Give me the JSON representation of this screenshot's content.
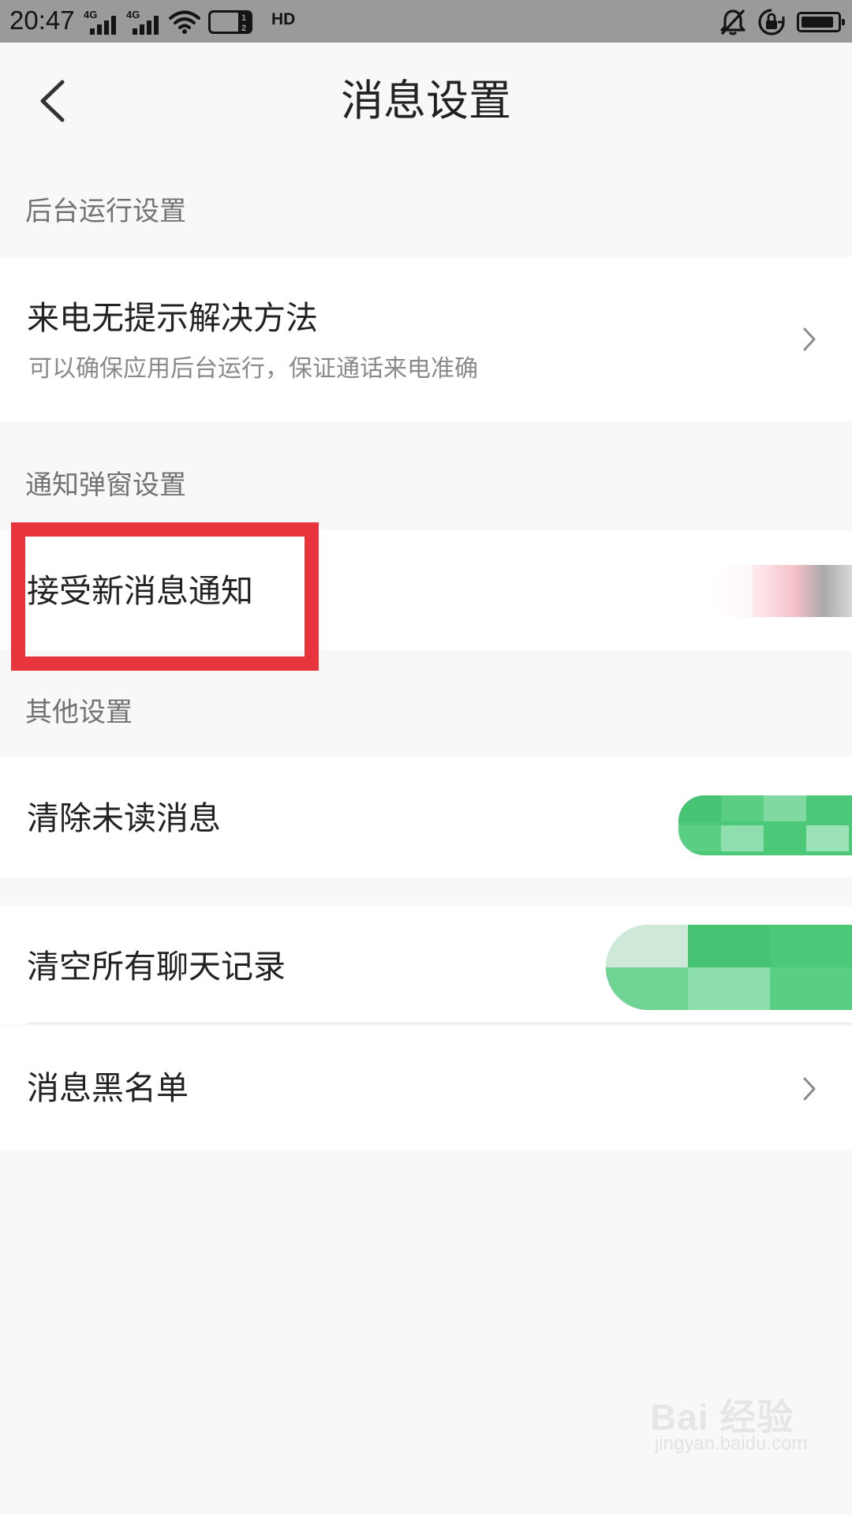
{
  "status_bar": {
    "time": "20:47",
    "network_1": "4G",
    "network_2": "4G",
    "hd_label": "HD",
    "icons": [
      "signal-4g-icon",
      "signal-4g-icon",
      "wifi-icon",
      "hd-voice-icon",
      "bell-muted-icon",
      "rotation-lock-icon",
      "battery-icon"
    ],
    "battery_level": 0.9
  },
  "header": {
    "back_icon": "chevron-left-icon",
    "title": "消息设置"
  },
  "sections": {
    "background": {
      "header": "后台运行设置",
      "items": [
        {
          "title": "来电无提示解决方法",
          "subtitle": "可以确保应用后台运行，保证通话来电准确",
          "trailing_icon": "chevron-right-icon"
        }
      ]
    },
    "notifications": {
      "header": "通知弹窗设置",
      "items": [
        {
          "title": "接受新消息通知",
          "control": "switch"
        }
      ]
    },
    "other": {
      "header": "其他设置",
      "items": [
        {
          "title": "清除未读消息",
          "control": "button"
        },
        {
          "title": "清空所有聊天记录",
          "control": "button"
        },
        {
          "title": "消息黑名单",
          "trailing_icon": "chevron-right-icon"
        }
      ]
    }
  },
  "colors": {
    "background": "#f8f8f8",
    "card": "#ffffff",
    "accent_green": "#4cc879",
    "highlight_red": "#e8343c",
    "status_bar": "#9a9a9a"
  },
  "watermark": {
    "logo": "Bai 经验",
    "url": "jingyan.baidu.com"
  }
}
